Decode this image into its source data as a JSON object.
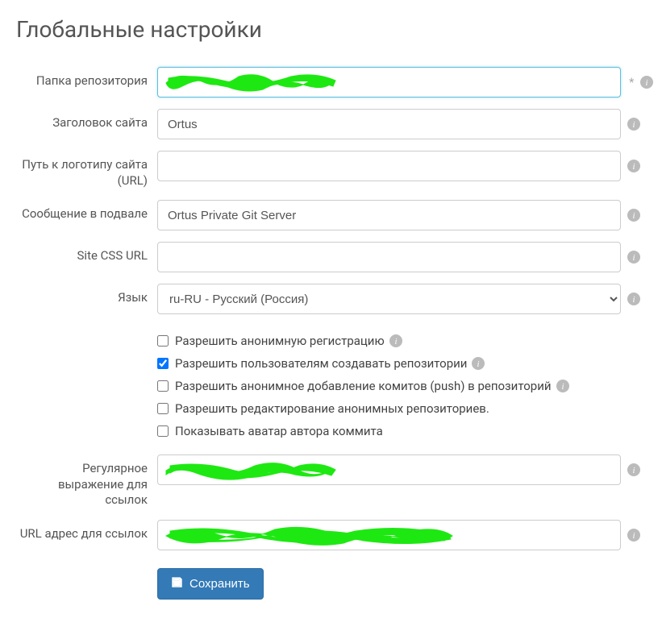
{
  "page": {
    "title": "Глобальные настройки"
  },
  "labels": {
    "repo_folder": "Папка репозитория",
    "site_title": "Заголовок сайта",
    "logo_url": "Путь к логотипу сайта (URL)",
    "footer_message": "Сообщение в подвале",
    "site_css_url": "Site CSS URL",
    "language": "Язык",
    "link_regex": "Регулярное выражение для ссылок",
    "link_url": "URL адрес для ссылок"
  },
  "values": {
    "repo_folder": "",
    "site_title": "Ortus",
    "logo_url": "",
    "footer_message": "Ortus Private Git Server",
    "site_css_url": "",
    "language": "ru-RU - Русский (Россия)",
    "link_regex": "",
    "link_url": ""
  },
  "checkboxes": {
    "allow_anon_registration": {
      "label": "Разрешить анонимную регистрацию",
      "checked": false,
      "info": true
    },
    "allow_users_create_repos": {
      "label": "Разрешить пользователям создавать репозитории",
      "checked": true,
      "info": true
    },
    "allow_anon_push": {
      "label": "Разрешить анонимное добавление комитов (push) в репозиторий",
      "checked": false,
      "info": true
    },
    "allow_edit_anon_repos": {
      "label": "Разрешить редактирование анонимных репозиториев.",
      "checked": false,
      "info": false
    },
    "show_commit_avatar": {
      "label": "Показывать аватар автора коммита",
      "checked": false,
      "info": false
    }
  },
  "buttons": {
    "save": "Сохранить"
  },
  "required_mark": "*"
}
